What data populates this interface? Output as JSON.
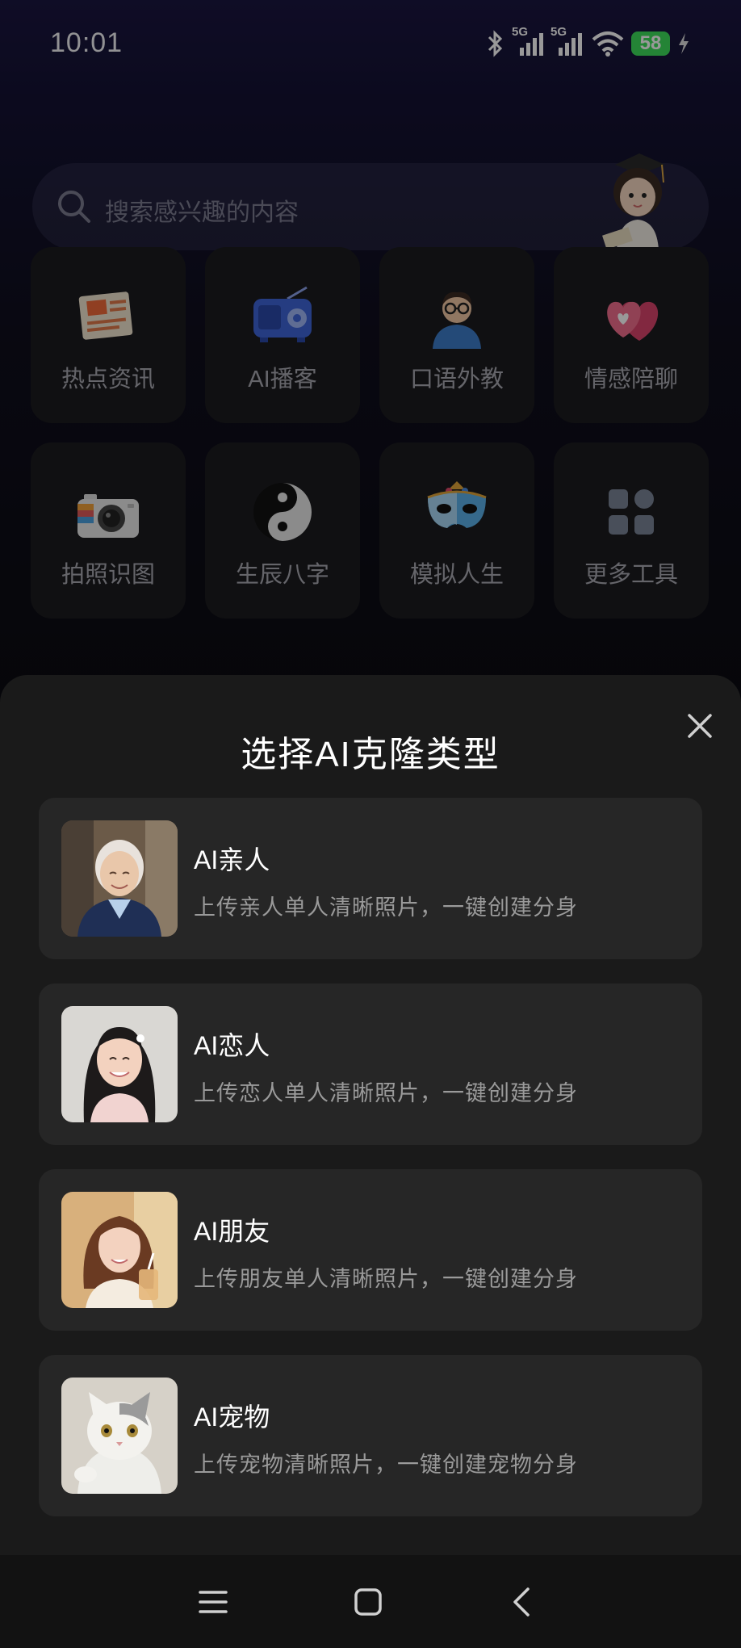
{
  "status_bar": {
    "time": "10:01",
    "signal_1": "5G",
    "signal_2": "5G",
    "battery": "58"
  },
  "search": {
    "placeholder": "搜索感兴趣的内容"
  },
  "tools": [
    {
      "label": "热点资讯",
      "icon": "newspaper-icon"
    },
    {
      "label": "AI播客",
      "icon": "radio-icon"
    },
    {
      "label": "口语外教",
      "icon": "teacher-icon"
    },
    {
      "label": "情感陪聊",
      "icon": "hearts-icon"
    },
    {
      "label": "拍照识图",
      "icon": "camera-icon"
    },
    {
      "label": "生辰八字",
      "icon": "yin-yang-icon"
    },
    {
      "label": "模拟人生",
      "icon": "mask-icon"
    },
    {
      "label": "更多工具",
      "icon": "grid-icon"
    }
  ],
  "sheet": {
    "title": "选择AI克隆类型",
    "options": [
      {
        "name": "AI亲人",
        "desc": "上传亲人单人清晰照片，一键创建分身",
        "icon": "elderly-woman-photo"
      },
      {
        "name": "AI恋人",
        "desc": "上传恋人单人清晰照片，一键创建分身",
        "icon": "young-woman-photo"
      },
      {
        "name": "AI朋友",
        "desc": "上传朋友单人清晰照片，一键创建分身",
        "icon": "friend-photo"
      },
      {
        "name": "AI宠物",
        "desc": "上传宠物清晰照片，一键创建宠物分身",
        "icon": "cat-photo"
      }
    ]
  },
  "colors": {
    "battery_green": "#3ddc5a",
    "sheet_bg": "#1a1a1a",
    "card_bg": "#262626"
  }
}
